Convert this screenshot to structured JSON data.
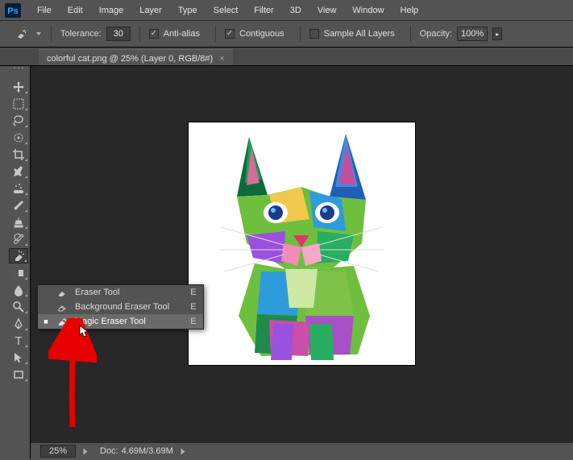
{
  "app": {
    "logo_text": "Ps"
  },
  "menubar": [
    "File",
    "Edit",
    "Image",
    "Layer",
    "Type",
    "Select",
    "Filter",
    "3D",
    "View",
    "Window",
    "Help"
  ],
  "options": {
    "tolerance_label": "Tolerance:",
    "tolerance_value": "30",
    "antialias_label": "Anti-alias",
    "antialias_checked": true,
    "contiguous_label": "Contiguous",
    "contiguous_checked": true,
    "sample_all_label": "Sample All Layers",
    "sample_all_checked": false,
    "opacity_label": "Opacity:",
    "opacity_value": "100%"
  },
  "document": {
    "tab_title": "colorful cat.png @ 25% (Layer 0, RGB/8#)",
    "tab_close": "×"
  },
  "flyout": {
    "items": [
      {
        "label": "Eraser Tool",
        "shortcut": "E",
        "selected": false
      },
      {
        "label": "Background Eraser Tool",
        "shortcut": "E",
        "selected": false
      },
      {
        "label": "Magic Eraser Tool",
        "shortcut": "E",
        "selected": true
      }
    ]
  },
  "status": {
    "zoom": "25%",
    "doc_label": "Doc:",
    "doc_value": "4.69M/3.69M"
  },
  "tool_icons": {
    "move": "move-icon",
    "marquee": "marquee-icon",
    "lasso": "lasso-icon",
    "wand": "wand-icon",
    "crop": "crop-icon",
    "eyedropper": "eyedropper-icon",
    "heal": "heal-icon",
    "brush": "brush-icon",
    "stamp": "stamp-icon",
    "history": "history-icon",
    "eraser": "eraser-icon",
    "gradient": "gradient-icon",
    "blur": "blur-icon",
    "dodge": "dodge-icon",
    "pen": "pen-icon",
    "type": "type-icon",
    "path": "path-icon",
    "shape": "shape-icon"
  }
}
